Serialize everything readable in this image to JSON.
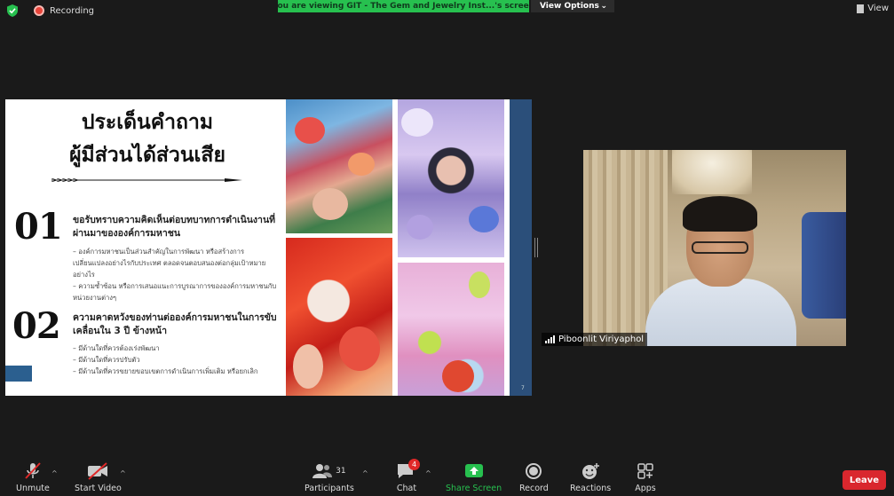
{
  "top_bar": {
    "recording_label": "Recording",
    "share_banner": "You are viewing GIT - The Gem and Jewelry Inst...'s screen",
    "view_options_label": "View Options",
    "view_label": "View"
  },
  "slide": {
    "title_line1": "ประเด็นคำถาม",
    "title_line2": "ผู้มีส่วนได้ส่วนเสีย",
    "q1_number": "01",
    "q1_heading": "ขอรับทราบความคิดเห็นต่อบทบาทการดำเนินงานที่ผ่านมาขององค์การมหาชน",
    "q1_bullet1": "– องค์การมหาชนเป็นส่วนสำคัญในการพัฒนา หรือสร้างการเปลี่ยนแปลงอย่างไรกับประเทศ ตลอดจนตอบสนองต่อกลุ่มเป้าหมายอย่างไร",
    "q1_bullet2": "– ความซ้ำซ้อน หรือการเสนอแนะการบูรณาการขององค์การมหาชนกับหน่วยงานต่างๆ",
    "q2_number": "02",
    "q2_heading": "ความคาดหวังของท่านต่อองค์การมหาชนในการขับเคลื่อนใน 3 ปี ข้างหน้า",
    "q2_bullet1": "– มีด้านใดที่ควรต้องเร่งพัฒนา",
    "q2_bullet2": "– มีด้านใดที่ควรปรับตัว",
    "q2_bullet3": "– มีด้านใดที่ควรขยายขอบเขตการดำเนินการเพิ่มเติม หรือยกเลิก",
    "page_number": "7"
  },
  "participant": {
    "name": "Piboonlit Viriyaphol"
  },
  "toolbar": {
    "unmute_label": "Unmute",
    "start_video_label": "Start Video",
    "participants_label": "Participants",
    "participants_count": "31",
    "chat_label": "Chat",
    "chat_badge": "4",
    "share_screen_label": "Share Screen",
    "record_label": "Record",
    "reactions_label": "Reactions",
    "apps_label": "Apps",
    "leave_label": "Leave"
  },
  "colors": {
    "share_banner": "#27c04f",
    "leave": "#d9272e",
    "slide_accent": "#2b4f7a"
  }
}
